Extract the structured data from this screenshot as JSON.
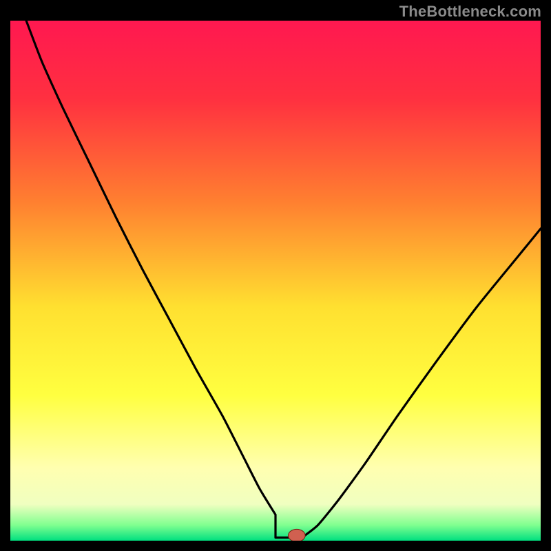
{
  "watermark": "TheBottleneck.com",
  "chart_data": {
    "type": "line",
    "title": "",
    "xlabel": "",
    "ylabel": "",
    "xlim": [
      0,
      100
    ],
    "ylim": [
      0,
      100
    ],
    "grid": false,
    "legend": false,
    "background_gradient": {
      "stops": [
        {
          "offset": 0.0,
          "color": "#ff1850"
        },
        {
          "offset": 0.15,
          "color": "#ff3040"
        },
        {
          "offset": 0.35,
          "color": "#ff8030"
        },
        {
          "offset": 0.55,
          "color": "#ffe030"
        },
        {
          "offset": 0.72,
          "color": "#ffff40"
        },
        {
          "offset": 0.86,
          "color": "#ffffb0"
        },
        {
          "offset": 0.93,
          "color": "#f0ffc0"
        },
        {
          "offset": 0.97,
          "color": "#80ff90"
        },
        {
          "offset": 1.0,
          "color": "#00e080"
        }
      ]
    },
    "series": [
      {
        "name": "bottleneck-curve",
        "x": [
          3,
          6,
          10,
          15,
          20,
          25,
          30,
          35,
          40,
          44,
          47,
          50,
          52,
          53.5,
          55,
          58,
          62,
          67,
          73,
          80,
          88,
          96,
          100
        ],
        "y": [
          100,
          92,
          83,
          72.5,
          62,
          52,
          42.5,
          33,
          24,
          16,
          10,
          5,
          2,
          0.5,
          0.5,
          3,
          8,
          15,
          24,
          34,
          45,
          55,
          60
        ]
      }
    ],
    "marker": {
      "name": "optimal-point",
      "x": 54,
      "y": 1,
      "color": "#d06050",
      "rx": 1.6,
      "ry": 1.2
    },
    "flat_segment": {
      "x_start": 50,
      "x_end": 55,
      "y": 0.6
    }
  }
}
